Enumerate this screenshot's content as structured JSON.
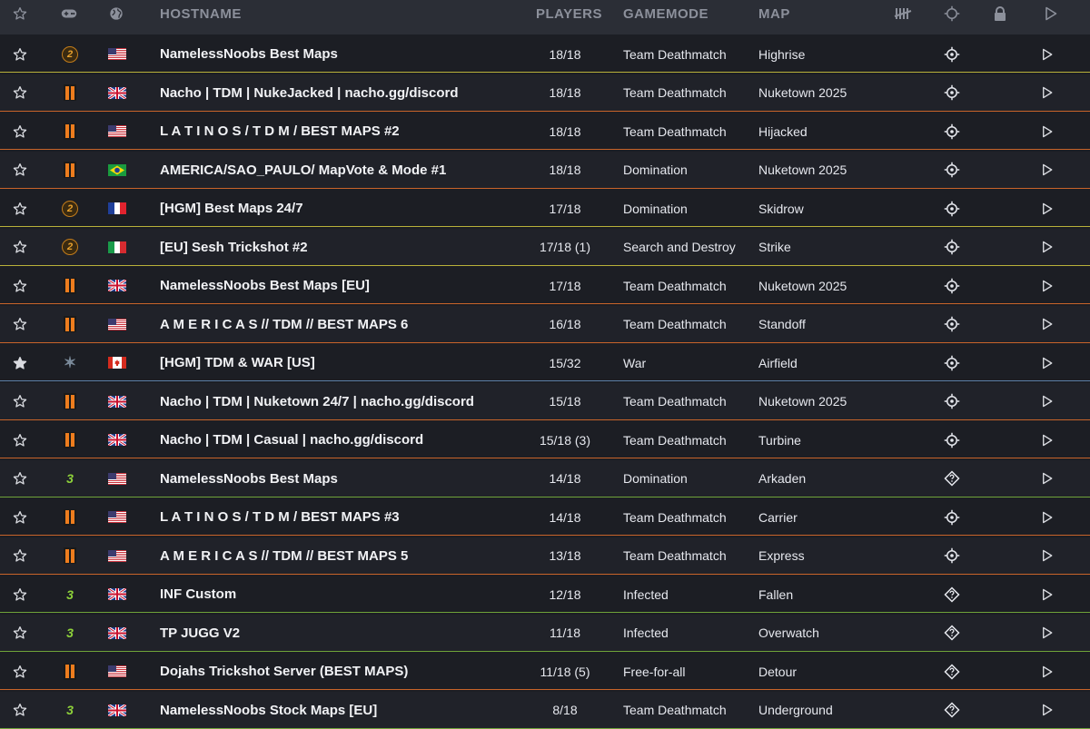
{
  "header": {
    "star_icon": "star-outline-icon",
    "game_icon": "gamepad-icon",
    "region_icon": "globe-icon",
    "hostname": "HOSTNAME",
    "players": "PLAYERS",
    "gamemode": "GAMEMODE",
    "map": "MAP",
    "tally_icon": "tally-icon",
    "crosshair_icon": "crosshair-icon",
    "lock_icon": "lock-icon",
    "play_icon": "play-icon"
  },
  "colors": {
    "background": "#1c1e24",
    "header_bg": "#2b2e36",
    "header_text": "#8c909b",
    "orange_line": "#c8642a",
    "green_line": "#6fa339",
    "yellow_line": "#b9b13a",
    "blue_line": "#5d7fa6"
  },
  "servers": [
    {
      "favorite": false,
      "game": "iw4x-2",
      "flag": "us",
      "hostname": "NamelessNoobs Best Maps",
      "players": "18/18",
      "gamemode": "Team Deathmatch",
      "map": "Highrise",
      "status_icon": "crosshair",
      "line": "yellow"
    },
    {
      "favorite": false,
      "game": "bo",
      "flag": "uk",
      "hostname": "Nacho | TDM | NukeJacked | nacho.gg/discord",
      "players": "18/18",
      "gamemode": "Team Deathmatch",
      "map": "Nuketown 2025",
      "status_icon": "crosshair",
      "line": "orange"
    },
    {
      "favorite": false,
      "game": "bo",
      "flag": "us",
      "hostname": "L A T I N O S / T D M / BEST MAPS #2",
      "players": "18/18",
      "gamemode": "Team Deathmatch",
      "map": "Hijacked",
      "status_icon": "crosshair",
      "line": "orange"
    },
    {
      "favorite": false,
      "game": "bo",
      "flag": "br",
      "hostname": "AMERICA/SAO_PAULO/ MapVote & Mode #1",
      "players": "18/18",
      "gamemode": "Domination",
      "map": "Nuketown 2025",
      "status_icon": "crosshair",
      "line": "orange"
    },
    {
      "favorite": false,
      "game": "iw4x-2",
      "flag": "fr",
      "hostname": "[HGM] Best Maps 24/7",
      "players": "17/18",
      "gamemode": "Domination",
      "map": "Skidrow",
      "status_icon": "crosshair",
      "line": "yellow"
    },
    {
      "favorite": false,
      "game": "iw4x-2",
      "flag": "it",
      "hostname": "[EU] Sesh Trickshot #2",
      "players": "17/18 (1)",
      "gamemode": "Search and Destroy",
      "map": "Strike",
      "status_icon": "crosshair",
      "line": "yellow"
    },
    {
      "favorite": false,
      "game": "bo",
      "flag": "uk",
      "hostname": "NamelessNoobs Best Maps [EU]",
      "players": "17/18",
      "gamemode": "Team Deathmatch",
      "map": "Nuketown 2025",
      "status_icon": "crosshair",
      "line": "orange"
    },
    {
      "favorite": false,
      "game": "bo",
      "flag": "us",
      "hostname": "A M E R I C A S // TDM // BEST MAPS 6",
      "players": "16/18",
      "gamemode": "Team Deathmatch",
      "map": "Standoff",
      "status_icon": "crosshair",
      "line": "orange"
    },
    {
      "favorite": true,
      "game": "star",
      "flag": "ca",
      "hostname": "[HGM] TDM & WAR [US]",
      "players": "15/32",
      "gamemode": "War",
      "map": "Airfield",
      "status_icon": "crosshair",
      "line": "blue"
    },
    {
      "favorite": false,
      "game": "bo",
      "flag": "uk",
      "hostname": "Nacho | TDM | Nuketown 24/7 | nacho.gg/discord",
      "players": "15/18",
      "gamemode": "Team Deathmatch",
      "map": "Nuketown 2025",
      "status_icon": "crosshair",
      "line": "orange"
    },
    {
      "favorite": false,
      "game": "bo",
      "flag": "uk",
      "hostname": "Nacho | TDM | Casual | nacho.gg/discord",
      "players": "15/18 (3)",
      "gamemode": "Team Deathmatch",
      "map": "Turbine",
      "status_icon": "crosshair",
      "line": "orange"
    },
    {
      "favorite": false,
      "game": "mw3",
      "flag": "us",
      "hostname": "NamelessNoobs Best Maps",
      "players": "14/18",
      "gamemode": "Domination",
      "map": "Arkaden",
      "status_icon": "unknown",
      "line": "green"
    },
    {
      "favorite": false,
      "game": "bo",
      "flag": "us",
      "hostname": "L A T I N O S / T D M / BEST MAPS #3",
      "players": "14/18",
      "gamemode": "Team Deathmatch",
      "map": "Carrier",
      "status_icon": "crosshair",
      "line": "orange"
    },
    {
      "favorite": false,
      "game": "bo",
      "flag": "us",
      "hostname": "A M E R I C A S // TDM // BEST MAPS 5",
      "players": "13/18",
      "gamemode": "Team Deathmatch",
      "map": "Express",
      "status_icon": "crosshair",
      "line": "orange"
    },
    {
      "favorite": false,
      "game": "mw3",
      "flag": "uk",
      "hostname": "INF Custom",
      "players": "12/18",
      "gamemode": "Infected",
      "map": "Fallen",
      "status_icon": "unknown",
      "line": "green"
    },
    {
      "favorite": false,
      "game": "mw3",
      "flag": "uk",
      "hostname": "TP JUGG V2",
      "players": "11/18",
      "gamemode": "Infected",
      "map": "Overwatch",
      "status_icon": "unknown",
      "line": "green"
    },
    {
      "favorite": false,
      "game": "bo",
      "flag": "us",
      "hostname": "Dojahs Trickshot Server (BEST MAPS)",
      "players": "11/18 (5)",
      "gamemode": "Free-for-all",
      "map": "Detour",
      "status_icon": "unknown",
      "line": "orange"
    },
    {
      "favorite": false,
      "game": "mw3",
      "flag": "uk",
      "hostname": "NamelessNoobs Stock Maps [EU]",
      "players": "8/18",
      "gamemode": "Team Deathmatch",
      "map": "Underground",
      "status_icon": "unknown",
      "line": "green"
    }
  ]
}
